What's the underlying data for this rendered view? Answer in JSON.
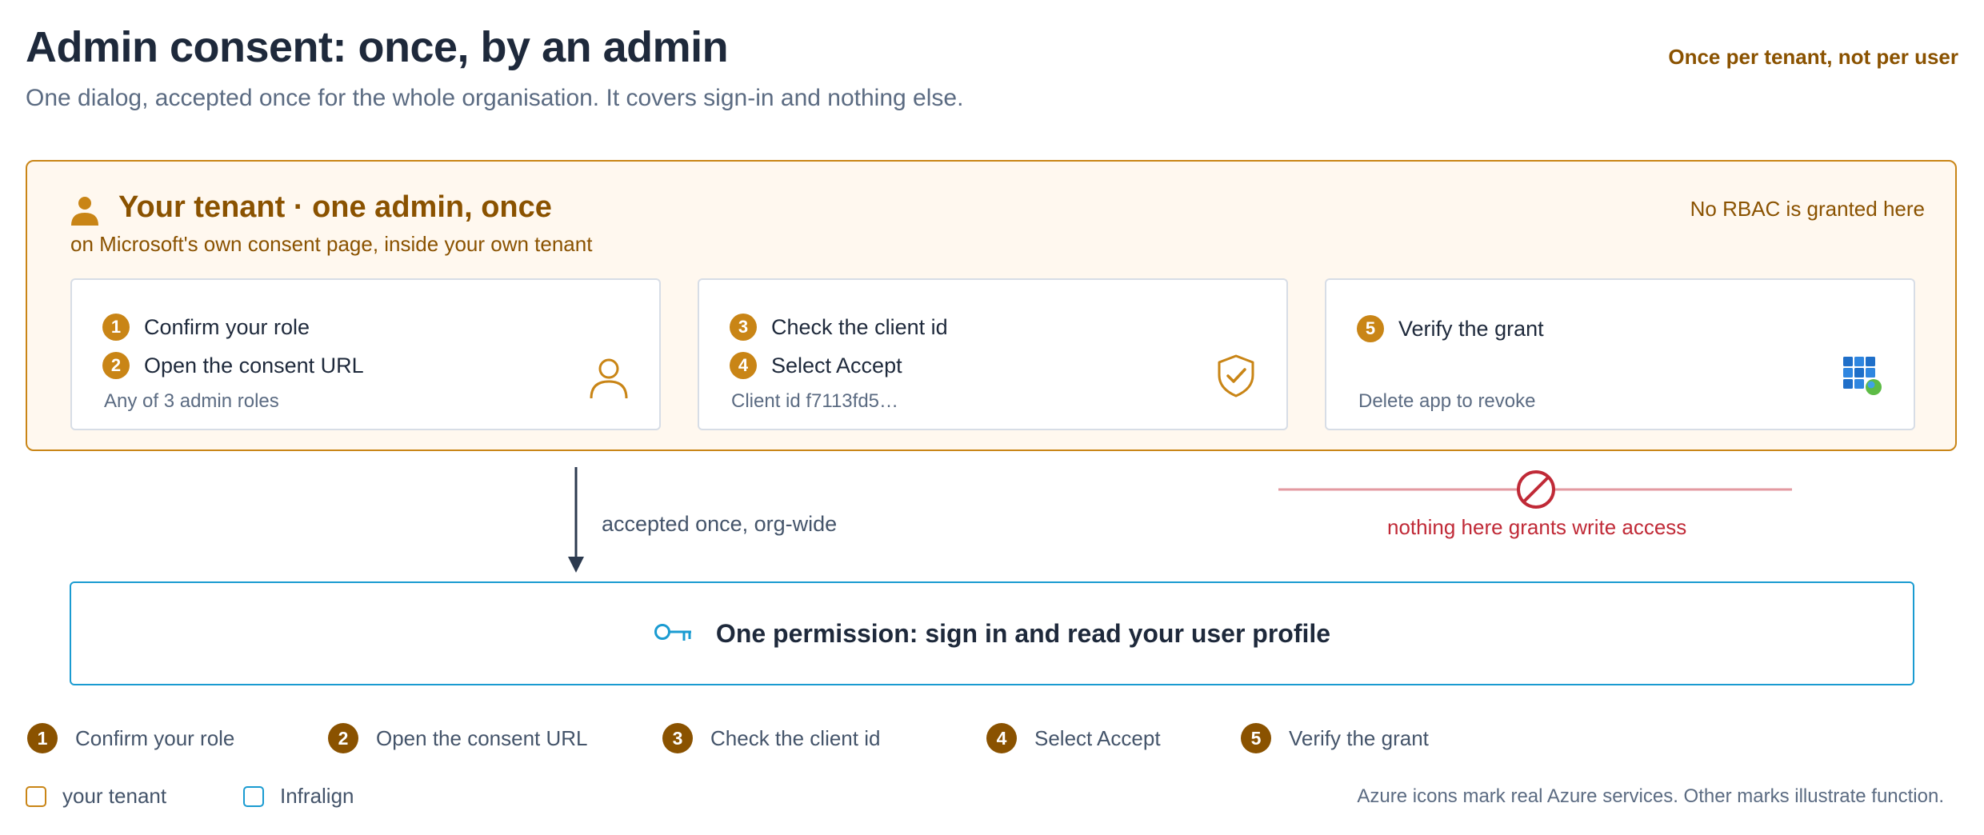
{
  "header": {
    "title": "Admin consent: once, by an admin",
    "subtitle": "One dialog, accepted once for the whole organisation. It covers sign-in and nothing else.",
    "badge": "Once per tenant, not per user"
  },
  "tenant": {
    "title": "Your tenant · one admin, once",
    "subtitle": "on Microsoft's own consent page, inside your own tenant",
    "note": "No RBAC is granted here",
    "cards": [
      {
        "steps": [
          {
            "num": "1",
            "text": "Confirm your role"
          },
          {
            "num": "2",
            "text": "Open the consent URL"
          }
        ],
        "note": "Any of 3 admin roles",
        "icon": "user-outline-icon"
      },
      {
        "steps": [
          {
            "num": "3",
            "text": "Check the client id"
          },
          {
            "num": "4",
            "text": "Select Accept"
          }
        ],
        "note": "Client id f7113fd5…",
        "icon": "shield-check-icon"
      },
      {
        "steps": [
          {
            "num": "5",
            "text": "Verify the grant"
          }
        ],
        "note": "Delete app to revoke",
        "icon": "azure-enterprise-apps-icon"
      }
    ]
  },
  "flow": {
    "arrow_label": "accepted once, org-wide",
    "deny_label": "nothing here grants write access"
  },
  "permission": {
    "text": "One permission: sign in and read your user profile",
    "icon": "key-icon"
  },
  "legend": {
    "steps": [
      {
        "num": "1",
        "text": "Confirm your role"
      },
      {
        "num": "2",
        "text": "Open the consent URL"
      },
      {
        "num": "3",
        "text": "Check the client id"
      },
      {
        "num": "4",
        "text": "Select Accept"
      },
      {
        "num": "5",
        "text": "Verify the grant"
      }
    ],
    "swatches": [
      {
        "label": "your tenant",
        "color": "#c98516"
      },
      {
        "label": "Infralign",
        "color": "#1a9bd1"
      }
    ],
    "footnote": "Azure icons mark real Azure services. Other marks illustrate function."
  },
  "colors": {
    "accent_amber": "#c98516",
    "amber_text": "#8a5200",
    "panel_bg": "#fff8ef",
    "blue": "#1a9bd1",
    "deny_red": "#c02a37"
  }
}
